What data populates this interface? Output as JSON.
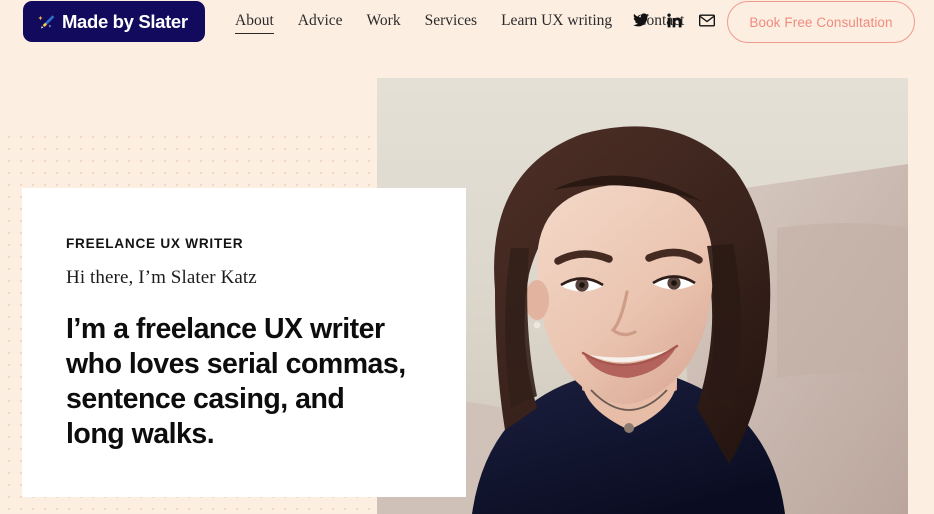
{
  "colors": {
    "page_background": "#fdeee2",
    "logo_badge": "#120a5c",
    "card_background": "#ffffff",
    "accent_coral": "#f08c7d",
    "text_dark": "#141414",
    "dot_pattern": "#f2d6c2"
  },
  "navbar": {
    "logo": {
      "icon": "magic-wand-icon",
      "text": "Made by Slater"
    },
    "links": [
      {
        "label": "About",
        "active": true
      },
      {
        "label": "Advice",
        "active": false
      },
      {
        "label": "Work",
        "active": false
      },
      {
        "label": "Services",
        "active": false
      },
      {
        "label": "Learn UX writing",
        "active": false
      },
      {
        "label": "Contact",
        "active": false
      }
    ],
    "social": [
      {
        "name": "twitter-icon",
        "label": "Twitter"
      },
      {
        "name": "linkedin-icon",
        "label": "LinkedIn"
      },
      {
        "name": "email-icon",
        "label": "Email"
      }
    ],
    "cta": {
      "label": "Book Free Consultation"
    }
  },
  "hero": {
    "card": {
      "eyebrow": "FREELANCE UX WRITER",
      "subtitle": "Hi there, I’m Slater Katz",
      "headline_lines": [
        "I’m a freelance UX writer",
        "who loves serial commas,",
        "sentence casing, and",
        "long walks."
      ]
    },
    "photo": {
      "alt": "Portrait photograph of Slater Katz smiling, seated on a light sofa"
    }
  }
}
